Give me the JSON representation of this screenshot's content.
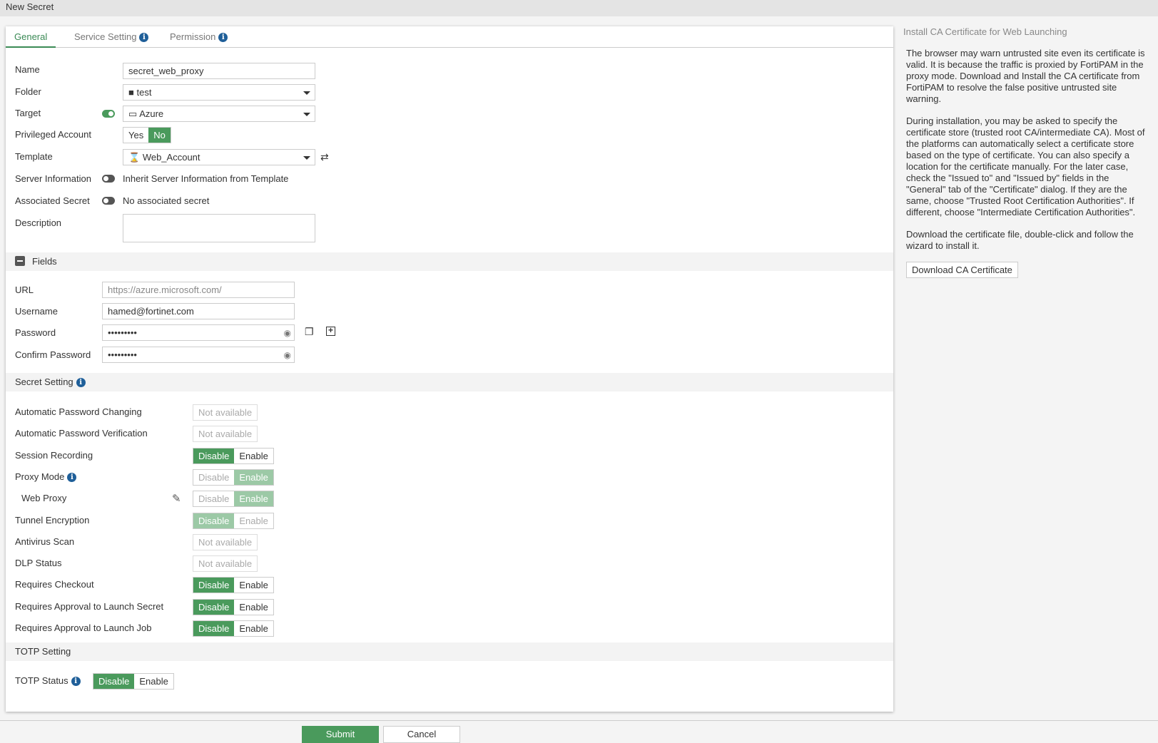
{
  "window": {
    "title": "New Secret"
  },
  "tabs": [
    {
      "label": "General"
    },
    {
      "label": "Service Setting"
    },
    {
      "label": "Permission"
    }
  ],
  "general": {
    "name": {
      "label": "Name",
      "value": "secret_web_proxy"
    },
    "folder": {
      "label": "Folder",
      "value": "test"
    },
    "target": {
      "label": "Target",
      "value": "Azure",
      "toggle": "on"
    },
    "privileged": {
      "label": "Privileged Account",
      "options": [
        "Yes",
        "No"
      ],
      "selected": "No"
    },
    "template": {
      "label": "Template",
      "value": "Web_Account"
    },
    "server_info": {
      "label": "Server Information",
      "text": "Inherit Server Information from Template",
      "toggle": "off"
    },
    "associated": {
      "label": "Associated Secret",
      "text": "No associated secret",
      "toggle": "off"
    },
    "description": {
      "label": "Description",
      "value": ""
    }
  },
  "fields": {
    "title": "Fields",
    "url": {
      "label": "URL",
      "placeholder": "https://azure.microsoft.com/"
    },
    "username": {
      "label": "Username",
      "value": "hamed@fortinet.com"
    },
    "password": {
      "label": "Password",
      "value": "•••••••••"
    },
    "confirm": {
      "label": "Confirm Password",
      "value": "•••••••••"
    }
  },
  "secret_setting": {
    "title": "Secret Setting",
    "disable": "Disable",
    "enable": "Enable",
    "not_available": "Not available",
    "rows": [
      {
        "label": "Automatic Password Changing",
        "state": "na"
      },
      {
        "label": "Automatic Password Verification",
        "state": "na"
      },
      {
        "label": "Session Recording",
        "state": "disable"
      },
      {
        "label": "Proxy Mode",
        "state": "enable-dim"
      },
      {
        "label": "Web Proxy",
        "state": "enable-dim"
      },
      {
        "label": "Tunnel Encryption",
        "state": "disable-dim"
      },
      {
        "label": "Antivirus Scan",
        "state": "na"
      },
      {
        "label": "DLP Status",
        "state": "na"
      },
      {
        "label": "Requires Checkout",
        "state": "disable"
      },
      {
        "label": "Requires Approval to Launch Secret",
        "state": "disable"
      },
      {
        "label": "Requires Approval to Launch Job",
        "state": "disable"
      }
    ]
  },
  "totp": {
    "title": "TOTP Setting",
    "status_label": "TOTP Status",
    "disable": "Disable",
    "enable": "Enable"
  },
  "side": {
    "title": "Install CA Certificate for Web Launching",
    "p1": "The browser may warn untrusted site even its certificate is valid. It is because the traffic is proxied by FortiPAM in the proxy mode. Download and Install the CA certificate from FortiPAM to resolve the false positive untrusted site warning.",
    "p2": "During installation, you may be asked to specify the certificate store (trusted root CA/intermediate CA). Most of the platforms can automatically select a certificate store based on the type of certificate. You can also specify a location for the certificate manually. For the later case, check the \"Issued to\" and \"Issued by\" fields in the \"General\" tab of the \"Certificate\" dialog. If they are the same, choose \"Trusted Root Certification Authorities\". If different, choose \"Intermediate Certification Authorities\".",
    "p3": "Download the certificate file, double-click and follow the wizard to install it.",
    "download": "Download CA Certificate"
  },
  "footer": {
    "submit": "Submit",
    "cancel": "Cancel"
  },
  "colors": {
    "accent": "#4a9a5c",
    "info": "#1f5f99"
  }
}
